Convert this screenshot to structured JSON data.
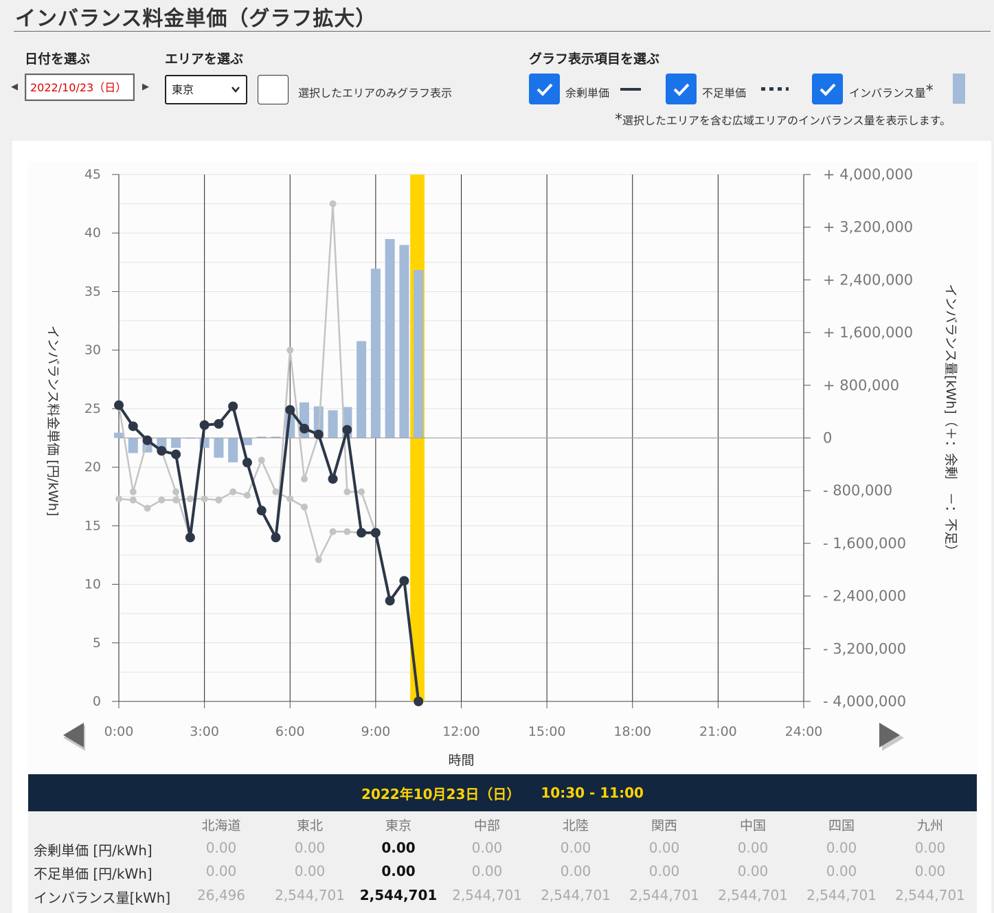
{
  "page": {
    "title": "インバランス料金単価（グラフ拡大）"
  },
  "controls": {
    "date_label": "日付を選ぶ",
    "date_value": "2022/10/23（日）",
    "area_label": "エリアを選ぶ",
    "area_value": "東京",
    "area_only_label": "選択したエリアのみグラフ表示",
    "graph_items_label": "グラフ表示項目を選ぶ",
    "surplus_label": "余剰単価",
    "shortage_label": "不足単価",
    "imbalance_label": "インバランス量",
    "imbalance_mark": "*",
    "note_mark": "*",
    "note_text": "選択したエリアを含む広域エリアのインバランス量を表示します。"
  },
  "chart_data": {
    "type": "line",
    "xlabel": "時間",
    "ylabel_left": "インバランス料金単価 [円/kWh]",
    "ylabel_right": "インバランス量[kWh]（＋：余剰　－：不足）",
    "x_ticks": [
      "0:00",
      "3:00",
      "6:00",
      "9:00",
      "12:00",
      "15:00",
      "18:00",
      "21:00",
      "24:00"
    ],
    "y_left_ticks": [
      "0",
      "5",
      "10",
      "15",
      "20",
      "25",
      "30",
      "35",
      "40",
      "45"
    ],
    "y_right_ticks": [
      "- 4,000,000",
      "- 3,200,000",
      "- 2,400,000",
      "- 1,600,000",
      "- 800,000",
      "0",
      "+ 800,000",
      "+ 1,600,000",
      "+ 2,400,000",
      "+ 3,200,000",
      "+ 4,000,000"
    ],
    "ylim_left": [
      0,
      45
    ],
    "ylim_right": [
      -4000000,
      4000000
    ],
    "x_range_hours": [
      0,
      24
    ],
    "grid": true,
    "highlight_interval_hours": [
      10.5,
      11.0
    ],
    "surplus_price": {
      "x": [
        0,
        0.5,
        1,
        1.5,
        2,
        2.5,
        3,
        3.5,
        4,
        4.5,
        5,
        5.5,
        6,
        6.5,
        7,
        7.5,
        8,
        8.5,
        9,
        9.5,
        10,
        10.5
      ],
      "y": [
        25.3,
        23.5,
        22.3,
        21.4,
        21.1,
        14.0,
        23.6,
        23.7,
        25.2,
        20.4,
        16.3,
        14.0,
        24.9,
        23.3,
        22.8,
        19.0,
        23.2,
        14.4,
        14.4,
        8.6,
        10.3,
        0.0
      ]
    },
    "gray_series_a": {
      "x": [
        0,
        0.5,
        1,
        1.5,
        2,
        2.5,
        3,
        3.5,
        4,
        4.5,
        5,
        5.5,
        6,
        6.5,
        7,
        7.5,
        8,
        8.5,
        9
      ],
      "y": [
        25.3,
        17.9,
        22.3,
        21.4,
        17.9,
        14.0,
        23.6,
        23.7,
        25.2,
        20.4,
        16.3,
        14.0,
        30.0,
        19.0,
        22.8,
        42.5,
        17.9,
        17.9,
        14.4
      ]
    },
    "gray_series_b": {
      "x": [
        0,
        0.5,
        1,
        1.5,
        2,
        2.5,
        3,
        3.5,
        4,
        4.5,
        5,
        5.5,
        6,
        6.5,
        7,
        7.5,
        8,
        8.5,
        9
      ],
      "y": [
        17.3,
        17.2,
        16.5,
        17.2,
        17.2,
        17.3,
        17.3,
        17.2,
        17.9,
        17.6,
        20.6,
        17.9,
        17.3,
        16.6,
        12.1,
        14.5,
        14.5,
        14.4,
        14.4
      ]
    },
    "imbalance_volume": {
      "x": [
        0,
        0.5,
        1,
        1.5,
        2,
        2.5,
        3,
        3.5,
        4,
        4.5,
        5,
        5.5,
        6,
        6.5,
        7,
        7.5,
        8,
        8.5,
        9,
        9.5,
        10,
        10.5
      ],
      "y": [
        80000,
        -230000,
        -220000,
        -200000,
        -150000,
        0,
        -150000,
        -300000,
        -370000,
        -110000,
        20000,
        20000,
        440000,
        540000,
        480000,
        420000,
        470000,
        1470000,
        2570000,
        3020000,
        2930000,
        2550000
      ]
    }
  },
  "table": {
    "header_date": "2022年10月23日（日）",
    "header_time": "10:30 - 11:00",
    "areas": [
      "北海道",
      "東北",
      "東京",
      "中部",
      "北陸",
      "関西",
      "中国",
      "四国",
      "九州"
    ],
    "selected_index": 2,
    "rows": [
      {
        "label": "余剰単価 [円/kWh]",
        "values": [
          "0.00",
          "0.00",
          "0.00",
          "0.00",
          "0.00",
          "0.00",
          "0.00",
          "0.00",
          "0.00"
        ]
      },
      {
        "label": "不足単価 [円/kWh]",
        "values": [
          "0.00",
          "0.00",
          "0.00",
          "0.00",
          "0.00",
          "0.00",
          "0.00",
          "0.00",
          "0.00"
        ]
      },
      {
        "label": "インバランス量[kWh]",
        "values": [
          "26,496",
          "2,544,701",
          "2,544,701",
          "2,544,701",
          "2,544,701",
          "2,544,701",
          "2,544,701",
          "2,544,701",
          "2,544,701"
        ]
      }
    ]
  },
  "colors": {
    "surplus_line": "#2d3748",
    "gray_line": "#c4c4c4",
    "bar": "#a3bad8",
    "highlight": "#ffd400",
    "checkbox": "#1a73e8",
    "table_header_bg": "#132640",
    "table_header_text": "#ffd400"
  },
  "icons": {
    "prev_small": "triangle-left-icon",
    "next_small": "triangle-right-icon",
    "select_chevron": "chevron-down-icon",
    "check": "checkmark-icon",
    "prev_big": "triangle-left-icon",
    "next_big": "triangle-right-icon"
  }
}
